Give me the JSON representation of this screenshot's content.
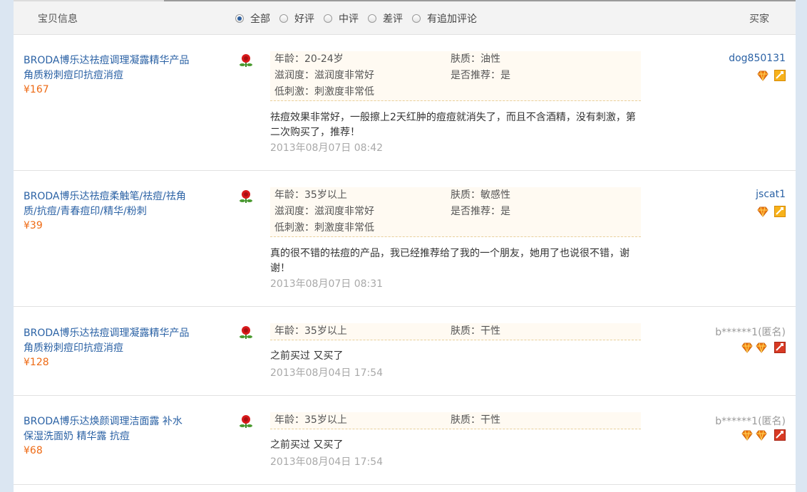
{
  "header": {
    "product_info_label": "宝贝信息",
    "buyer_label": "买家",
    "filters": [
      {
        "label": "全部",
        "selected": true
      },
      {
        "label": "好评",
        "selected": false
      },
      {
        "label": "中评",
        "selected": false
      },
      {
        "label": "差评",
        "selected": false
      },
      {
        "label": "有追加评论",
        "selected": false
      }
    ]
  },
  "reviews": [
    {
      "product": "BRODA博乐达祛痘调理凝露精华产品角质粉刺痘印抗痘消痘",
      "price": "¥167",
      "attrs": {
        "age": "年龄：20-24岁",
        "skin": "肤质：油性",
        "moist": "滋润度：滋润度非常好",
        "recommend": "是否推荐：是",
        "irritation": "低刺激：刺激度非常低"
      },
      "comment": "祛痘效果非常好，一般擦上2天红肿的痘痘就消失了，而且不含酒精，没有刺激，第二次购买了，推荐！",
      "date": "2013年08月07日 08:42",
      "buyer": "dog850131",
      "hearts": 1,
      "vip_icon": "vip-gold-icon"
    },
    {
      "product": "BRODA博乐达祛痘柔触笔/祛痘/祛角质/抗痘/青春痘印/精华/粉刺",
      "price": "¥39",
      "attrs": {
        "age": "年龄：35岁以上",
        "skin": "肤质：敏感性",
        "moist": "滋润度：滋润度非常好",
        "recommend": "是否推荐：是",
        "irritation": "低刺激：刺激度非常低"
      },
      "comment": "真的很不错的祛痘的产品，我已经推荐给了我的一个朋友，她用了也说很不错，谢谢！",
      "date": "2013年08月07日 08:31",
      "buyer": "jscat1",
      "hearts": 1,
      "vip_icon": "vip-gold-icon"
    },
    {
      "product": "BRODA博乐达祛痘调理凝露精华产品角质粉刺痘印抗痘消痘",
      "price": "¥128",
      "attrs": {
        "age": "年龄：35岁以上",
        "skin": "肤质：干性"
      },
      "comment": "之前买过 又买了",
      "date": "2013年08月04日 17:54",
      "buyer": "b******1(匿名)",
      "hearts": 2,
      "vip_icon": "vip-red-icon"
    },
    {
      "product": "BRODA博乐达焕颜调理洁面露 补水保湿洗面奶 精华露 抗痘",
      "price": "¥68",
      "attrs": {
        "age": "年龄：35岁以上",
        "skin": "肤质：干性"
      },
      "comment": "之前买过 又买了",
      "date": "2013年08月04日 17:54",
      "buyer": "b******1(匿名)",
      "hearts": 2,
      "vip_icon": "vip-red-icon"
    }
  ],
  "colors": {
    "link": "#2b62a5",
    "price": "#ee6a14",
    "date": "#a9a9a9",
    "attr_bg": "#fffaf2"
  }
}
